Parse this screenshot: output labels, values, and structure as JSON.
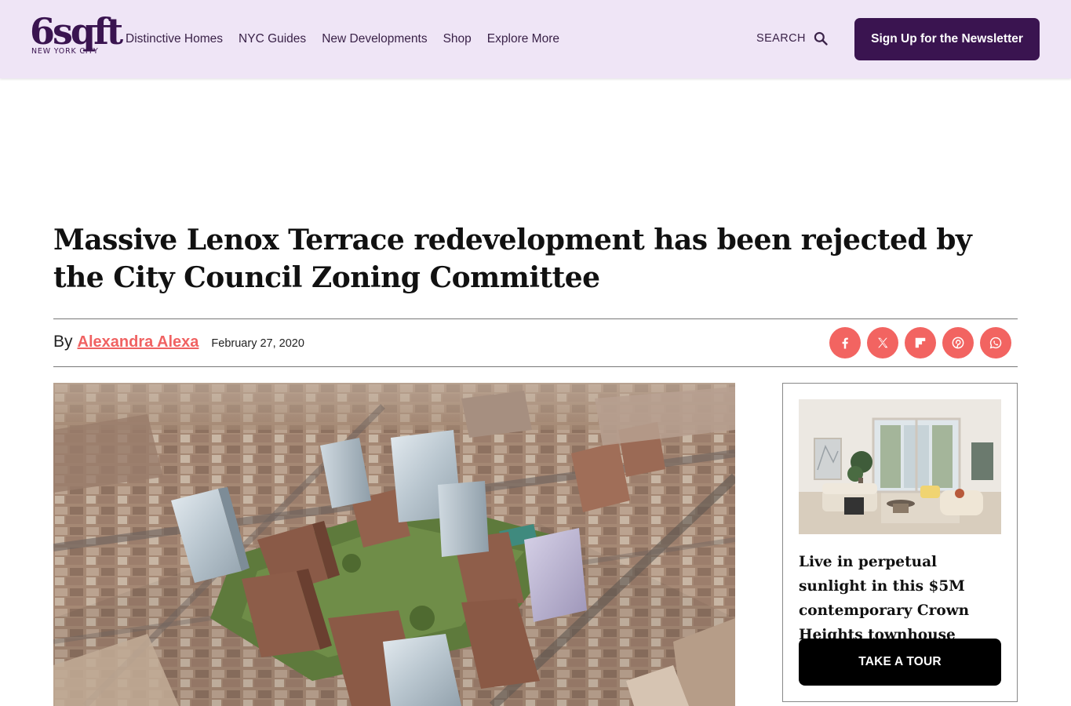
{
  "header": {
    "logo_main": "6sqft",
    "logo_sub": "NEW YORK CITY",
    "nav": [
      {
        "label": "Distinctive Homes"
      },
      {
        "label": "NYC Guides"
      },
      {
        "label": "New Developments"
      },
      {
        "label": "Shop"
      },
      {
        "label": "Explore More"
      }
    ],
    "search_label": "SEARCH",
    "newsletter_label": "Sign Up for the Newsletter"
  },
  "article": {
    "headline": "Massive Lenox Terrace redevelopment has been rejected by the City Council Zoning Committee",
    "by_prefix": "By",
    "author": "Alexandra Alexa",
    "date": "February 27, 2020",
    "share": [
      {
        "icon": "facebook-icon"
      },
      {
        "icon": "x-icon"
      },
      {
        "icon": "flipboard-icon"
      },
      {
        "icon": "pinterest-icon"
      },
      {
        "icon": "whatsapp-icon"
      }
    ]
  },
  "sidebar_ad": {
    "title": "Live in perpetual sunlight in this $5M contemporary Crown Heights townhouse",
    "button_label": "TAKE A TOUR"
  },
  "colors": {
    "header_bg": "#efe5f6",
    "brand_purple": "#3a1450",
    "accent_coral": "#f26461"
  }
}
